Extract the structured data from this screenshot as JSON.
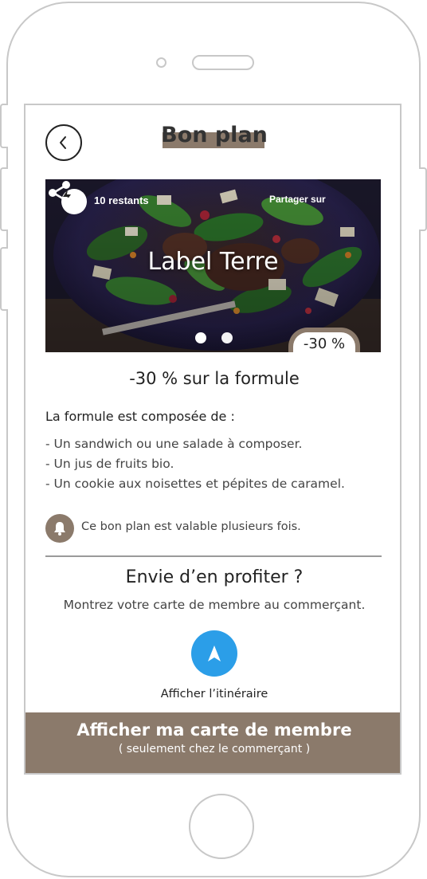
{
  "header": {
    "title": "Bon plan",
    "back_icon": "chevron-left-icon"
  },
  "hero": {
    "remaining_text": "10 restants",
    "share_label": "Partager sur",
    "share_icon": "share-icon",
    "lightning_icon": "lightning-icon",
    "merchant_name": "Label Terre",
    "discount_badge": "-30 %",
    "carousel": {
      "count": 2,
      "active": 1
    }
  },
  "offer": {
    "title": "-30 % sur la formule",
    "composed_label": "La formule est composée de :",
    "items": [
      "- Un sandwich ou une salade à composer.",
      "- Un jus de fruits bio.",
      "- Un cookie aux noisettes et pépites de caramel."
    ]
  },
  "notice": {
    "icon": "bell-icon",
    "text": "Ce bon plan est valable plusieurs fois."
  },
  "cta": {
    "title": "Envie d’en profiter ?",
    "subtitle": "Montrez votre carte de membre au commerçant.",
    "route_icon": "navigation-arrow-icon",
    "route_label": "Afficher l’itinéraire"
  },
  "member_button": {
    "label": "Afficher ma carte de membre",
    "sublabel": "( seulement chez le commerçant )"
  },
  "colors": {
    "brand": "#8b7a6b",
    "route_button": "#2b9ee8"
  }
}
